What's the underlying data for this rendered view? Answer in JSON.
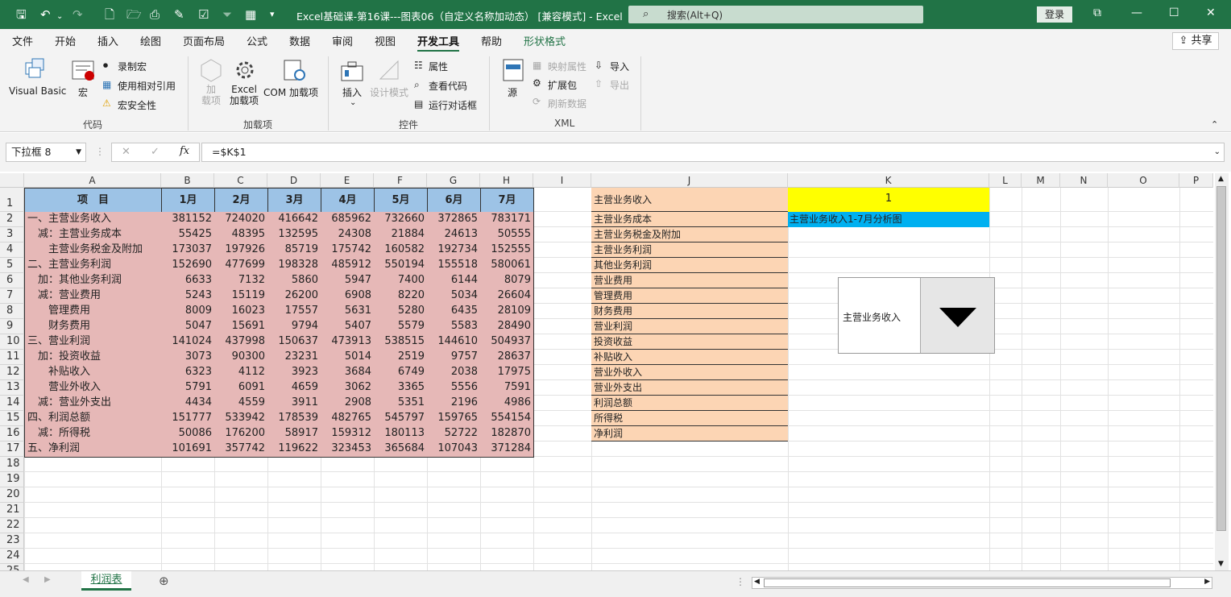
{
  "titlebar": {
    "title": "Excel基础课-第16课---图表06（自定义名称加动态） [兼容模式] - Excel",
    "search_placeholder": "搜索(Alt+Q)",
    "login": "登录"
  },
  "menu": [
    "文件",
    "开始",
    "插入",
    "绘图",
    "页面布局",
    "公式",
    "数据",
    "审阅",
    "视图",
    "开发工具",
    "帮助",
    "形状格式"
  ],
  "share_label": "共享",
  "ribbon": {
    "code": {
      "visual_basic": "Visual Basic",
      "macro": "宏",
      "record_macro": "录制宏",
      "relative_ref": "使用相对引用",
      "macro_security": "宏安全性",
      "group": "代码"
    },
    "addins": {
      "addins": "加\n载项",
      "excel_addins": "Excel\n加载项",
      "com_addins": "COM 加载项",
      "group": "加载项"
    },
    "controls": {
      "insert": "插入",
      "design_mode": "设计模式",
      "properties": "属性",
      "view_code": "查看代码",
      "run_dialog": "运行对话框",
      "group": "控件"
    },
    "xml": {
      "source": "源",
      "map_props": "映射属性",
      "expansion": "扩展包",
      "refresh": "刷新数据",
      "import": "导入",
      "export": "导出",
      "group": "XML"
    }
  },
  "formula_bar": {
    "name_box": "下拉框 8",
    "formula": "=$K$1"
  },
  "columns": [
    "A",
    "B",
    "C",
    "D",
    "E",
    "F",
    "G",
    "H",
    "I",
    "J",
    "K",
    "L",
    "M",
    "N",
    "O",
    "P"
  ],
  "table": {
    "headers": [
      "项　目",
      "1月",
      "2月",
      "3月",
      "4月",
      "5月",
      "6月",
      "7月"
    ],
    "rows": [
      [
        "一、主营业务收入",
        381152,
        724020,
        416642,
        685962,
        732660,
        372865,
        783171
      ],
      [
        "　减：主营业务成本",
        55425,
        48395,
        132595,
        24308,
        21884,
        24613,
        50555
      ],
      [
        "　　主营业务税金及附加",
        173037,
        197926,
        85719,
        175742,
        160582,
        192734,
        152555
      ],
      [
        "二、主营业务利润",
        152690,
        477699,
        198328,
        485912,
        550194,
        155518,
        580061
      ],
      [
        "　加：其他业务利润",
        6633,
        7132,
        5860,
        5947,
        7400,
        6144,
        8079
      ],
      [
        "　减：营业费用",
        5243,
        15119,
        26200,
        6908,
        8220,
        5034,
        26604
      ],
      [
        "　　管理费用",
        8009,
        16023,
        17557,
        5631,
        5280,
        6435,
        28109
      ],
      [
        "　　财务费用",
        5047,
        15691,
        9794,
        5407,
        5579,
        5583,
        28490
      ],
      [
        "三、营业利润",
        141024,
        437998,
        150637,
        473913,
        538515,
        144610,
        504937
      ],
      [
        "　加：投资收益",
        3073,
        90300,
        23231,
        5014,
        2519,
        9757,
        28637
      ],
      [
        "　　补贴收入",
        6323,
        4112,
        3923,
        3684,
        6749,
        2038,
        17975
      ],
      [
        "　　营业外收入",
        5791,
        6091,
        4659,
        3062,
        3365,
        5556,
        7591
      ],
      [
        "　减：营业外支出",
        4434,
        4559,
        3911,
        2908,
        5351,
        2196,
        4986
      ],
      [
        "四、利润总额",
        151777,
        533942,
        178539,
        482765,
        545797,
        159765,
        554154
      ],
      [
        "　减：所得税",
        50086,
        176200,
        58917,
        159312,
        180113,
        52722,
        182870
      ],
      [
        "五、净利润",
        101691,
        357742,
        119622,
        323453,
        365684,
        107043,
        371284
      ]
    ]
  },
  "list_j": [
    "主营业务收入",
    "主营业务成本",
    "主营业务税金及附加",
    "主营业务利润",
    "其他业务利润",
    "营业费用",
    "管理费用",
    "财务费用",
    "营业利润",
    "投资收益",
    "补贴收入",
    "营业外收入",
    "营业外支出",
    "利润总额",
    "所得税",
    "净利润"
  ],
  "k1": "1",
  "k2": "主营业务收入1-7月分析图",
  "dropdown": {
    "value": "主营业务收入"
  },
  "sheet_tab": "利润表",
  "colors": {
    "excel_green": "#217346",
    "header_blue": "#9dc3e6",
    "row_pink": "#e6b8b7",
    "list_orange": "#fcd5b4",
    "k1_yellow": "#ffff00",
    "k2_blue": "#00b0f0"
  }
}
